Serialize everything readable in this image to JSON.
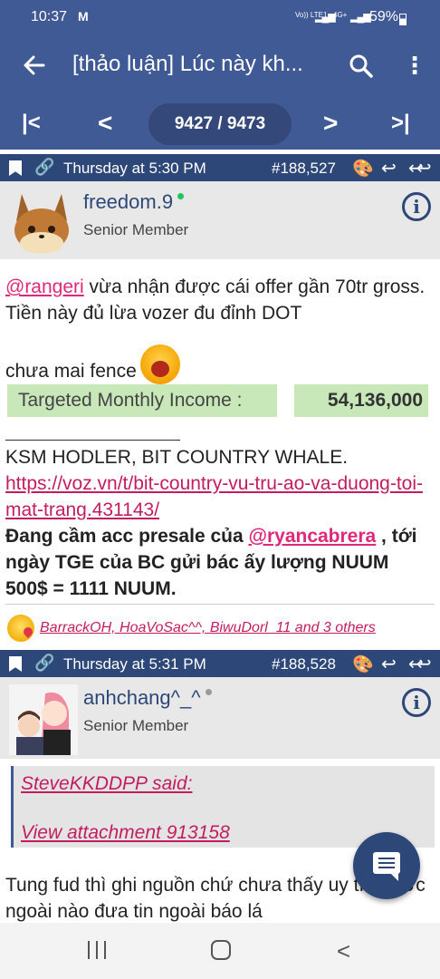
{
  "status_bar": {
    "time": "10:37",
    "mail_icon": "M",
    "network1": "Vo)) LTE1",
    "network2": "4G+",
    "battery": "59%"
  },
  "app_bar": {
    "title": "[thảo luận] Lúc này kh...",
    "back_icon": "arrow-left-icon",
    "search_icon": "search-icon",
    "more_icon": "more-vert-icon",
    "pagination": "9427 / 9473",
    "colors": {
      "bar": "#3f5a94",
      "pill": "#34497a",
      "post_bar": "#2d4878"
    }
  },
  "posts": [
    {
      "time": "Thursday at 5:30 PM",
      "number": "#188,527",
      "username": "freedom.9",
      "online": true,
      "user_title": "Senior Member",
      "mention": "@rangeri",
      "text1": " vừa nhận được cái offer gần 70tr gross. Tiền này đủ lừa vozer đu đỉnh DOT",
      "text2": "chưa mai fence",
      "income_label": "Targeted Monthly Income :",
      "income_value": "54,136,000",
      "sig_line1": "KSM HODLER, BIT COUNTRY WHALE.",
      "sig_link": "https://voz.vn/t/bit-country-vu-tru-ao-va-duong-toi-mat-trang.431143/",
      "sig_bold1": "Đang cầm acc presale của ",
      "sig_mention": "@ryancabrera",
      "sig_bold2": " , tới ngày TGE của BC gửi bác ấy lượng NUUM 500$ = 1111 NUUM.",
      "reactions": "BarrackOH, HoaVoSac^^, BiwuDorl_11 and 3 others"
    },
    {
      "time": "Thursday at 5:31 PM",
      "number": "#188,528",
      "username": "anhchang^_^",
      "online": false,
      "user_title": "Senior Member",
      "quote_author": "SteveKKDDPP said:",
      "quote_attachment": "View attachment 913158",
      "text": "Tung fud thì ghi nguồn chứ chưa thấy uy tín nước ngoài nào đưa tin ngoài báo lá"
    }
  ],
  "fab_icon": "chat-icon"
}
